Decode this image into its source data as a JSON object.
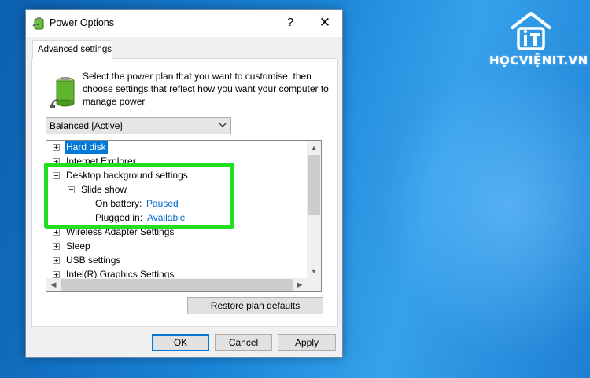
{
  "window": {
    "title": "Power Options",
    "help_glyph": "?",
    "close_glyph": "✕"
  },
  "tab": {
    "label": "Advanced settings"
  },
  "description": "Select the power plan that you want to customise, then choose settings that reflect how you want your computer to manage power.",
  "plan_select": {
    "value": "Balanced [Active]"
  },
  "tree": {
    "items": [
      {
        "label": "Hard disk",
        "expander": "plus",
        "selected": true
      },
      {
        "label": "Internet Explorer",
        "expander": "plus"
      },
      {
        "label": "Desktop background settings",
        "expander": "minus"
      },
      {
        "label": "Slide show",
        "expander": "minus"
      },
      {
        "label": "On battery:",
        "value": "Paused"
      },
      {
        "label": "Plugged in:",
        "value": "Available"
      },
      {
        "label": "Wireless Adapter Settings",
        "expander": "plus"
      },
      {
        "label": "Sleep",
        "expander": "plus"
      },
      {
        "label": "USB settings",
        "expander": "plus"
      },
      {
        "label": "Intel(R) Graphics Settings",
        "expander": "plus"
      }
    ]
  },
  "buttons": {
    "restore": "Restore plan defaults",
    "ok": "OK",
    "cancel": "Cancel",
    "apply": "Apply"
  },
  "watermark": {
    "text": "HỌCVIỆNIT.VN"
  },
  "colors": {
    "accent": "#0078d7",
    "highlight_box": "#1ee01e",
    "value_link": "#0066cc"
  }
}
